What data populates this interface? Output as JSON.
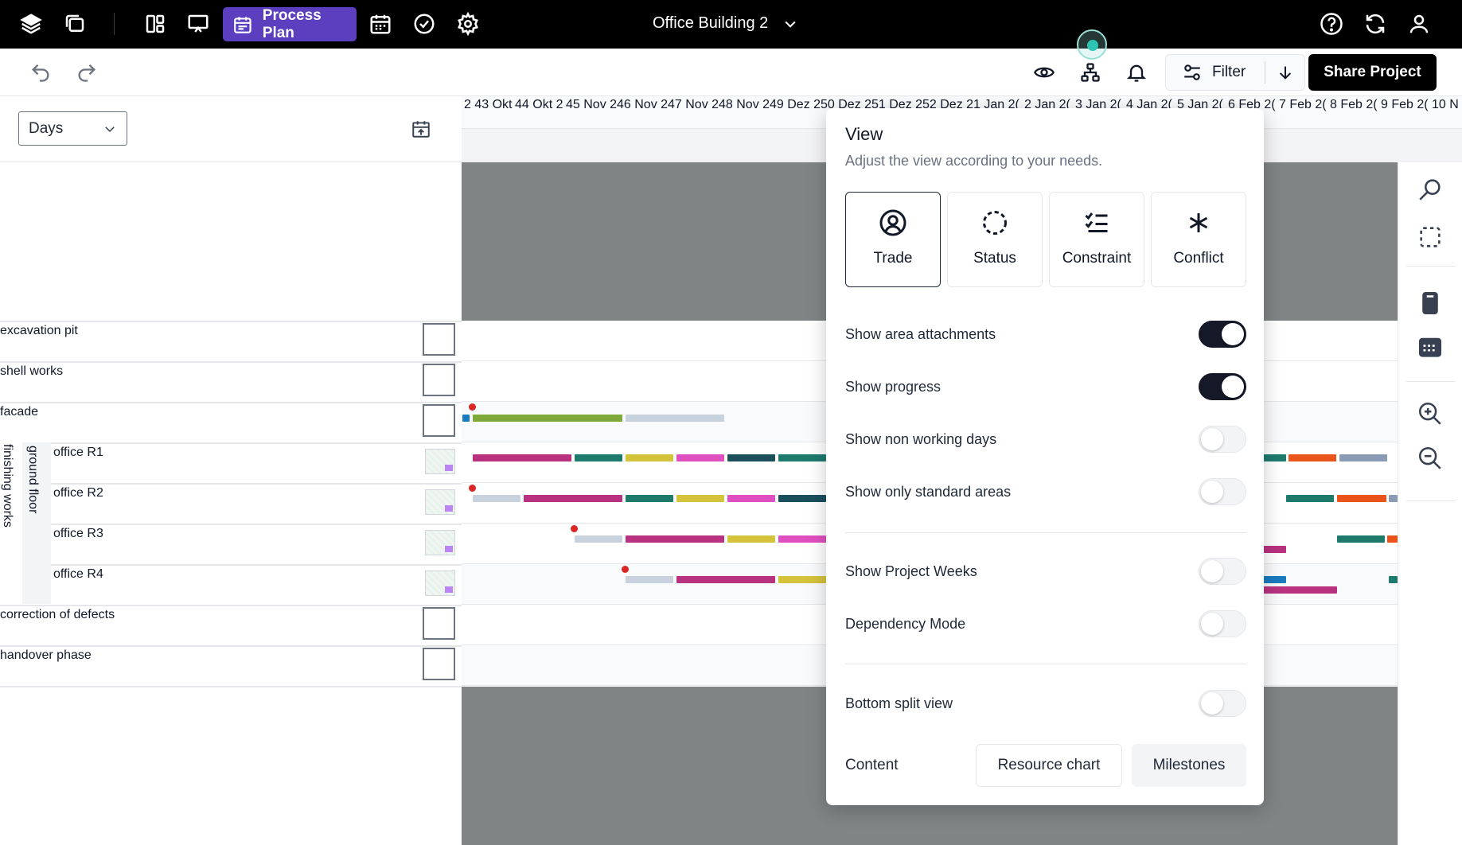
{
  "topbar": {
    "process_plan_label": "Process Plan",
    "project_title": "Office Building 2",
    "icons": [
      "layers-icon",
      "copy-icon",
      "layout-icon",
      "presentation-icon",
      "calendar-icon",
      "check-circle-icon",
      "gear-icon",
      "help-icon",
      "refresh-icon",
      "user-icon"
    ]
  },
  "toolbar": {
    "filter_label": "Filter",
    "share_label": "Share Project",
    "icons": [
      "undo-icon",
      "redo-icon",
      "eye-icon",
      "hierarchy-icon",
      "bell-icon",
      "sliders-icon",
      "arrow-down-icon"
    ]
  },
  "left": {
    "days_value": "Days",
    "rows": [
      "excavation pit",
      "shell works",
      "facade",
      "office R1",
      "office R2",
      "office R3",
      "office R4",
      "correction of defects",
      "handover phase"
    ],
    "group_outer": "finishing works",
    "group_inner": "ground floor"
  },
  "timeline": {
    "labels": [
      "2 43 Okt 2",
      "44 Okt 2",
      "45 Nov 2",
      "46 Nov 2",
      "47 Nov 2",
      "48 Nov 2",
      "49 Dez 2",
      "50 Dez 2",
      "51 Dez 2",
      "52 Dez 2",
      "1 Jan 2(",
      "2 Jan 2(",
      "3 Jan 2(",
      "4 Jan 2(",
      "5 Jan 2(",
      "6 Feb 2(",
      "7 Feb 2(",
      "8 Feb 2(",
      "9 Feb 2(",
      "10 N"
    ]
  },
  "view_popover": {
    "title": "View",
    "subtitle": "Adjust the view according to your needs.",
    "modes": [
      {
        "label": "Trade",
        "icon": "user-circle-icon",
        "active": true
      },
      {
        "label": "Status",
        "icon": "dashed-circle-icon",
        "active": false
      },
      {
        "label": "Constraint",
        "icon": "checklist-icon",
        "active": false
      },
      {
        "label": "Conflict",
        "icon": "asterisk-icon",
        "active": false
      }
    ],
    "options": [
      {
        "label": "Show area attachments",
        "on": true
      },
      {
        "label": "Show progress",
        "on": true
      },
      {
        "label": "Show non working days",
        "on": false
      },
      {
        "label": "Show only standard areas",
        "on": false
      },
      {
        "label": "Show Project Weeks",
        "on": false
      },
      {
        "label": "Dependency Mode",
        "on": false
      },
      {
        "label": "Bottom split view",
        "on": false
      }
    ],
    "content_label": "Content",
    "content_buttons": [
      "Resource chart",
      "Milestones"
    ]
  },
  "colors": {
    "accent": "#5b3fbf",
    "toggle_on": "#141827",
    "gantt_gray": "#808485",
    "trade_magenta": "#b83280",
    "trade_teal": "#1f7a6e",
    "trade_yellow": "#d4c23a",
    "trade_pink": "#e04fbf",
    "trade_darkteal": "#1c4f5c",
    "trade_green": "#7fa83a",
    "trade_lightblue": "#c7d2de",
    "trade_orange": "#e8541a",
    "trade_blue": "#1a7bbf"
  }
}
